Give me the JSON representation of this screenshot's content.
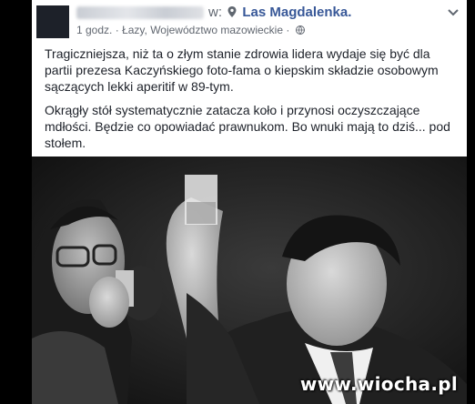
{
  "post": {
    "checkin_at": "w:",
    "place": "Las Magdalenka.",
    "time": "1 godz.",
    "location": "Łazy, Województwo mazowieckie",
    "meta_sep": "·",
    "paragraphs": [
      "Tragiczniejsza, niż ta o złym stanie zdrowia lidera wydaje się być dla partii prezesa Kaczyńskiego foto-fama o kiepskim składzie osobowym sączących lekki aperitif w 89-tym.",
      "Okrągły stół systematycznie zatacza koło i przynosi oczyszczające mdłości. Będzie co opowiadać prawnukom. Bo wnuki mają to dziś... pod stołem."
    ]
  },
  "photo": {
    "watermark": "www.wiocha.pl"
  },
  "icons": [
    "location-pin-icon",
    "globe-icon",
    "chevron-down-icon"
  ],
  "colors": {
    "link": "#385898",
    "text": "#1d2129",
    "meta": "#616770"
  }
}
